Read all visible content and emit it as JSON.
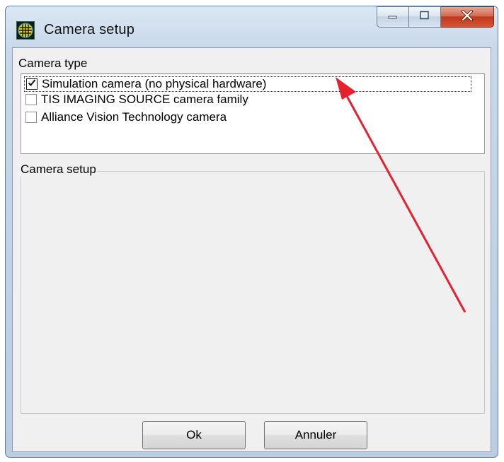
{
  "window": {
    "title": "Camera setup",
    "app_icon": "camera-grid-icon",
    "controls": {
      "minimize_icon": "minimize-icon",
      "maximize_icon": "maximize-icon",
      "close_icon": "close-icon"
    }
  },
  "camera_type": {
    "label": "Camera type",
    "items": [
      {
        "label": "Simulation camera (no physical hardware)",
        "checked": true,
        "focused": true
      },
      {
        "label": "TIS IMAGING SOURCE camera family",
        "checked": false
      },
      {
        "label": "Alliance Vision Technology camera",
        "checked": false
      }
    ]
  },
  "camera_setup": {
    "label": "Camera setup"
  },
  "buttons": {
    "ok": "Ok",
    "cancel": "Annuler"
  },
  "colors": {
    "annotation_arrow": "#e8202e",
    "close_button": "#c2371a"
  }
}
